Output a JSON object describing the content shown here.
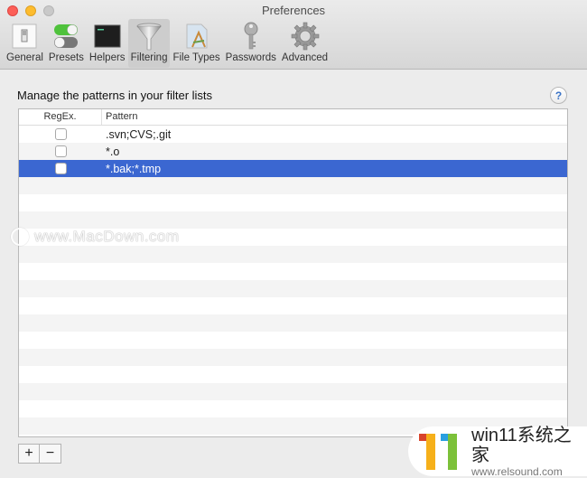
{
  "window": {
    "title": "Preferences",
    "controls": [
      "close",
      "minimize",
      "maximize"
    ]
  },
  "toolbar": {
    "items": [
      {
        "label": "General",
        "icon": "general-switch-icon",
        "active": false
      },
      {
        "label": "Presets",
        "icon": "toggle-switches-icon",
        "active": false
      },
      {
        "label": "Helpers",
        "icon": "terminal-icon",
        "active": false
      },
      {
        "label": "Filtering",
        "icon": "funnel-icon",
        "active": true
      },
      {
        "label": "File Types",
        "icon": "document-app-icon",
        "active": false
      },
      {
        "label": "Passwords",
        "icon": "key-icon",
        "active": false
      },
      {
        "label": "Advanced",
        "icon": "gear-icon",
        "active": false
      }
    ]
  },
  "main": {
    "heading": "Manage the patterns in your filter lists",
    "help_label": "?",
    "table": {
      "columns": [
        "RegEx.",
        "Pattern"
      ],
      "rows": [
        {
          "regex": false,
          "pattern": ".svn;CVS;.git",
          "selected": false
        },
        {
          "regex": false,
          "pattern": "*.o",
          "selected": false
        },
        {
          "regex": false,
          "pattern": "*.bak;*.tmp",
          "selected": true
        }
      ]
    },
    "add_label": "+",
    "remove_label": "−"
  },
  "overlays": {
    "watermark": "www.MacDown.com",
    "badge_title": "win11系统之家",
    "badge_sub": "www.relsound.com"
  },
  "colors": {
    "selection": "#3b67d1",
    "close": "#fc5f57",
    "minimize": "#fdbc2e",
    "maximize": "#c9c9c9"
  }
}
